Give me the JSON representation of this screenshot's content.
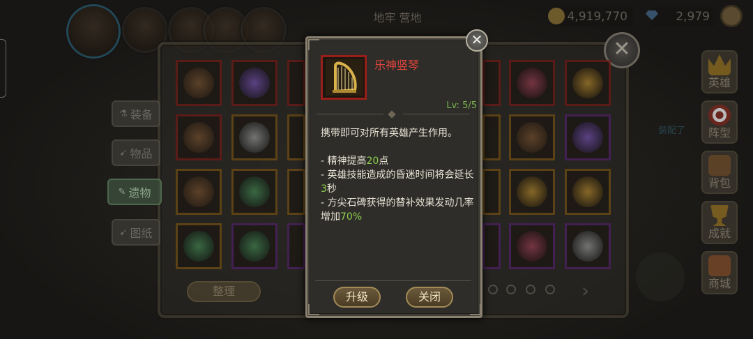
{
  "topbar": {
    "title": "地牢 营地",
    "gold_amount": "4,919,770",
    "gem_amount": "2,979"
  },
  "side_tabs": [
    {
      "label": "装备",
      "icon": "flask-icon",
      "active": false
    },
    {
      "label": "物品",
      "icon": "bow-icon",
      "active": false
    },
    {
      "label": "遗物",
      "icon": "relic-icon",
      "active": true
    },
    {
      "label": "图纸",
      "icon": "blueprint-icon",
      "active": false
    }
  ],
  "sort_button": "整理",
  "right_menu": [
    {
      "label": "英雄",
      "icon": "crown-icon"
    },
    {
      "label": "阵型",
      "icon": "target-icon"
    },
    {
      "label": "背包",
      "icon": "bag-icon"
    },
    {
      "label": "成就",
      "icon": "trophy-icon"
    },
    {
      "label": "商城",
      "icon": "shop-icon"
    }
  ],
  "background_hint": "装配了",
  "item_popup": {
    "name": "乐神竖琴",
    "icon": "harp-icon",
    "level": "Lv: 5/5",
    "intro": "携带即可对所有英雄产生作用。",
    "effects": [
      {
        "pre": "- 精神提高",
        "hl": "20",
        "post": "点"
      },
      {
        "pre": "- 英雄技能造成的昏迷时间将会延长",
        "hl": "3",
        "post": "秒"
      },
      {
        "pre": "- 方尖石碑获得的替补效果发动几率增加",
        "hl": "70%",
        "post": ""
      }
    ],
    "upgrade_label": "升级",
    "close_label": "关闭"
  },
  "colors": {
    "item_name": "#e0443c",
    "level": "#7ab34e",
    "highlight": "#8fcf4f",
    "frame_red": "#9a1e18",
    "frame_purple": "#4b2060",
    "frame_gold": "#6b4a14"
  }
}
